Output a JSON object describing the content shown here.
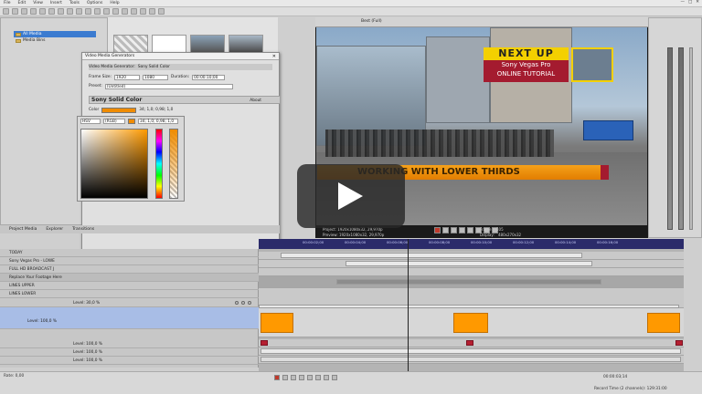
{
  "menu": [
    "File",
    "Edit",
    "View",
    "Insert",
    "Tools",
    "Options",
    "Help"
  ],
  "window_controls": [
    "—",
    "□",
    "✕"
  ],
  "explorer": {
    "items": [
      {
        "label": "All Media",
        "selected": true
      },
      {
        "label": "Media Bins",
        "selected": false
      }
    ]
  },
  "dialog": {
    "title": "Video Media Generators",
    "header_label": "Video Media Generator:",
    "header_value": "Sony Solid Color",
    "frame_size_label": "Frame Size:",
    "frame_w": "1920",
    "frame_h": "1080",
    "duration_label": "Duration:",
    "duration_value": "00:00:10;00",
    "preset_label": "Preset:",
    "preset_value": "(Untitled)",
    "section_title": "Sony Solid Color",
    "about_label": "About",
    "color_label": "Color",
    "color_value": "34; 1,0; 0,98; 1,0",
    "color_swatch": "#f08c00"
  },
  "picker": {
    "mode": "HSV",
    "space": "(RGB)",
    "value": "34; 1,0; 0,98; 1,0",
    "base_hue": "#ff9a00"
  },
  "tabs": [
    "Project Media",
    "Explorer",
    "Transitions"
  ],
  "preview": {
    "toolbar_label": "Best (Full)",
    "next_up": "NEXT UP",
    "tut_line1": "Sony Vegas Pro",
    "tut_line2": "ONLINE TUTORIAL",
    "lower_third": "WORKING WITH LOWER THIRDS",
    "info_project": "Project: 1920x1080x32, 29,970p",
    "info_preview": "Preview: 1920x1080x32, 29,970p",
    "frame_label": "Frame:",
    "frame_value": "105",
    "display_label": "Display:",
    "display_value": "480x270x32"
  },
  "tracks": [
    {
      "name": "TODAY",
      "level": ""
    },
    {
      "name": "Sony Vegas Pro - LOWE",
      "level": ""
    },
    {
      "name": "FULL HD BROADCAST J",
      "level": ""
    },
    {
      "name": "Replace Your Footage Here",
      "level": ""
    },
    {
      "name": "LINES UPPER",
      "level": ""
    },
    {
      "name": "LINES LOWER",
      "level": ""
    },
    {
      "name": "",
      "level": "Level: 30,0 %"
    },
    {
      "name": "",
      "level": ""
    },
    {
      "name": "",
      "level": "Level: 100,0 %"
    },
    {
      "name": "",
      "level": ""
    },
    {
      "name": "",
      "level": "Level: 100,0 %"
    },
    {
      "name": "",
      "level": "Level: 100,0 %"
    },
    {
      "name": "",
      "level": "Level: 100,0 %"
    }
  ],
  "ruler_ticks": [
    "00:00:02;00",
    "00:00:04;00",
    "00:00:06;00",
    "00:00:08;00",
    "00:00:10;00",
    "00:00:12;00",
    "00:00:14;00",
    "00:00:16;00"
  ],
  "status": {
    "rate_label": "Rate: 0,00",
    "timecode": "00:00:03;14",
    "record_time": "Record Time (2 channels): 129:31:00"
  },
  "colors": {
    "accent_orange": "#ff9900",
    "title_yellow": "#f4d000",
    "title_red": "#a41b2f",
    "selection_blue": "#3b7bd0"
  }
}
